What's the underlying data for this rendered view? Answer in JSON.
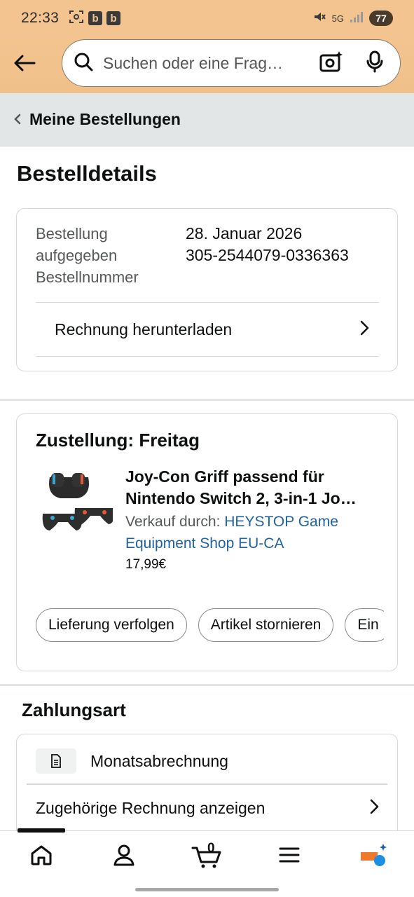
{
  "status_bar": {
    "time": "22:33",
    "badges": [
      "b",
      "b"
    ],
    "network": "5G",
    "battery": "77",
    "icons": [
      "scan-icon",
      "mute-icon",
      "signal-icon"
    ]
  },
  "search": {
    "placeholder": "Suchen oder eine Frag…",
    "icons": [
      "back-arrow-icon",
      "search-icon",
      "camera-lens-icon",
      "microphone-icon"
    ]
  },
  "breadcrumb": {
    "label": "Meine Bestellungen"
  },
  "page": {
    "title": "Bestelldetails"
  },
  "order": {
    "label_placed": "Bestellung aufgegeben",
    "label_number": "Bestellnummer",
    "date": "28. Januar 2026",
    "number": "305-2544079-0336363",
    "invoice_download": "Rechnung herunterladen"
  },
  "delivery": {
    "title": "Zustellung: Freitag",
    "product": {
      "title": "Joy-Con Griff passend für Nintendo Switch 2, 3-in-1 Jo…",
      "seller_prefix": "Verkauf durch:",
      "seller": "HEYSTOP Game Equipment Shop EU-CA",
      "price": "17,99€"
    },
    "actions": [
      "Lieferung verfolgen",
      "Artikel stornieren",
      "Ein"
    ]
  },
  "payment": {
    "title": "Zahlungsart",
    "method": "Monatsabrechnung",
    "related_invoice": "Zugehörige Rechnung anzeigen"
  },
  "bottom_nav": {
    "cart_count": "0",
    "items": [
      "home-icon",
      "account-icon",
      "cart-icon",
      "menu-icon",
      "rufus-icon"
    ]
  },
  "colors": {
    "header_bg": "#f3c48f",
    "link": "#2162a1",
    "breadcrumb_bg": "#e3e6e6"
  }
}
